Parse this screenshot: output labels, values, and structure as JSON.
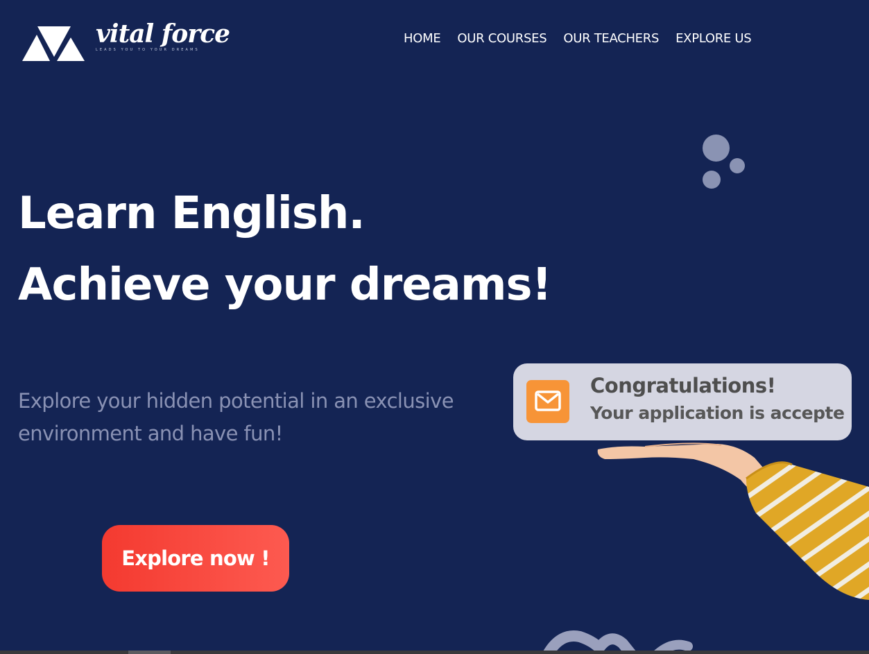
{
  "brand": {
    "name": "vital force",
    "tagline": "LEADS YOU TO YOUR DREAMS"
  },
  "nav": {
    "items": [
      "HOME",
      "OUR COURSES",
      "OUR TEACHERS",
      "EXPLORE US"
    ]
  },
  "hero": {
    "headline_line1": "Learn English.",
    "headline_line2": "Achieve your dreams!",
    "subtitle": "Explore your hidden potential in an exclusive environment and have fun!",
    "cta_label": "Explore now !"
  },
  "notification": {
    "title": "Congratulations!",
    "message": "Your application is accepte",
    "icon": "mail-icon"
  },
  "colors": {
    "background": "#142454",
    "cta_start": "#f43a30",
    "cta_end": "#fd5a50",
    "notification_bg": "#d5d6e2",
    "mail_icon_bg": "#f79437",
    "decor_bubbles": "#8a93b3",
    "sleeve_yellow": "#e0a726"
  }
}
